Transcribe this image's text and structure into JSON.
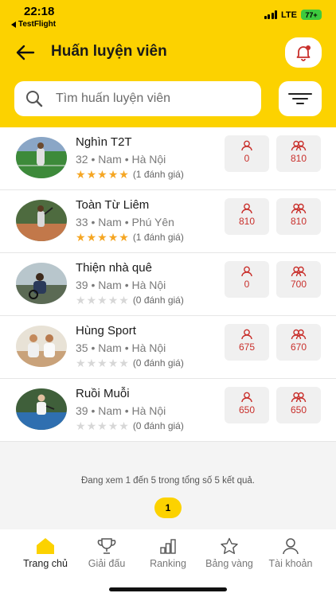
{
  "status_bar": {
    "time": "22:18",
    "back_app": "TestFlight",
    "network": "LTE",
    "battery": "77+"
  },
  "header": {
    "title": "Huấn luyện viên"
  },
  "search": {
    "placeholder": "Tìm huấn luyện viên"
  },
  "coaches": [
    {
      "name": "Nghìn T2T",
      "info": "32 • Nam • Hà Nội",
      "stars": 5,
      "reviews": "(1 đánh giá)",
      "stat_single": "0",
      "stat_double": "810"
    },
    {
      "name": "Toàn Từ Liêm",
      "info": "33 • Nam • Phú Yên",
      "stars": 5,
      "reviews": "(1 đánh giá)",
      "stat_single": "810",
      "stat_double": "810"
    },
    {
      "name": "Thiện nhà quê",
      "info": "39 • Nam • Hà Nội",
      "stars": 0,
      "reviews": "(0 đánh giá)",
      "stat_single": "0",
      "stat_double": "700"
    },
    {
      "name": "Hùng Sport",
      "info": "35 • Nam • Hà Nội",
      "stars": 0,
      "reviews": "(0 đánh giá)",
      "stat_single": "675",
      "stat_double": "670"
    },
    {
      "name": "Ruồi Muỗi",
      "info": "39 • Nam • Hà Nội",
      "stars": 0,
      "reviews": "(0 đánh giá)",
      "stat_single": "650",
      "stat_double": "650"
    }
  ],
  "pagination": {
    "summary": "Đang xem 1 đến 5 trong tổng số 5 kết quả.",
    "current_page": "1"
  },
  "tabs": [
    {
      "label": "Trang chủ",
      "icon": "home-icon",
      "active": true
    },
    {
      "label": "Giải đấu",
      "icon": "trophy-icon",
      "active": false
    },
    {
      "label": "Ranking",
      "icon": "bar-chart-icon",
      "active": false
    },
    {
      "label": "Bảng vàng",
      "icon": "star-icon",
      "active": false
    },
    {
      "label": "Tài khoản",
      "icon": "user-icon",
      "active": false
    }
  ],
  "colors": {
    "brand_yellow": "#fcd200",
    "stat_red": "#c9302c",
    "star_on": "#f5a623",
    "star_off": "#d7d7d7"
  }
}
